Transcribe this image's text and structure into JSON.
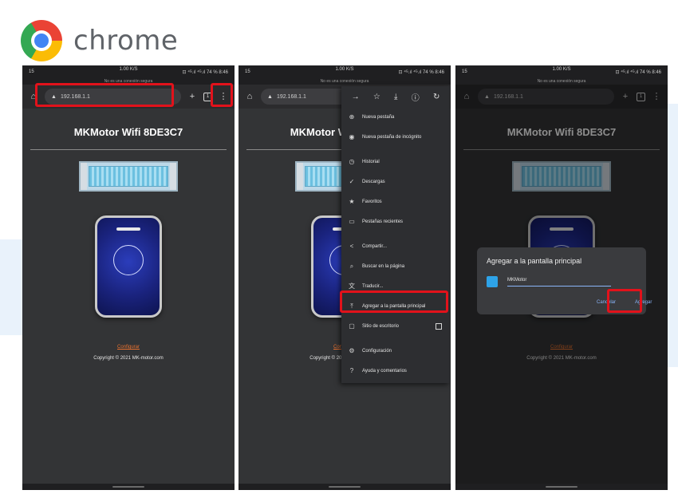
{
  "header": {
    "brand_text": "chrome",
    "logo_icon": "chrome-logo-icon"
  },
  "status": {
    "left": "15",
    "center_top": "1.00 K/S",
    "right": "⊡ ⁴ᴳ.ıl ⁴ᴳ.ıl 74 % 8:46"
  },
  "not_secure": "No es una conexión segura",
  "toolbar": {
    "url": "192.168.1.1",
    "warning_icon": "warning-icon",
    "new_tab": "+",
    "tab_count": "1",
    "menu": "⋮"
  },
  "page": {
    "title": "MKMotor Wifi 8DE3C7",
    "config_link": "Configurar",
    "copyright": "Copyright © 2021 MK-motor.com"
  },
  "menu": {
    "top_icons": [
      "→",
      "☆",
      "⤓",
      "ⓘ",
      "↻"
    ],
    "items": [
      {
        "icon": "⊕",
        "label": "Nueva pestaña"
      },
      {
        "icon": "◉",
        "label": "Nueva pestaña de incógnito"
      },
      {
        "icon": "◷",
        "label": "Historial"
      },
      {
        "icon": "✓",
        "label": "Descargas"
      },
      {
        "icon": "★",
        "label": "Favoritos"
      },
      {
        "icon": "▭",
        "label": "Pestañas recientes"
      },
      {
        "icon": "<",
        "label": "Compartir..."
      },
      {
        "icon": "⌕",
        "label": "Buscar en la página"
      },
      {
        "icon": "文",
        "label": "Traducir..."
      },
      {
        "icon": "⤒",
        "label": "Agregar a la pantalla principal"
      },
      {
        "icon": "▢",
        "label": "Sitio de escritorio"
      },
      {
        "icon": "⚙",
        "label": "Configuración"
      },
      {
        "icon": "?",
        "label": "Ayuda y comentarios"
      }
    ]
  },
  "dialog": {
    "title": "Agregar a la pantalla principal",
    "input_value": "MKMotor",
    "cancel": "Cancelar",
    "add": "Agregar"
  },
  "colors": {
    "highlight": "#e2121b",
    "link": "#e8712f",
    "dialog_accent": "#8ab4f8"
  }
}
